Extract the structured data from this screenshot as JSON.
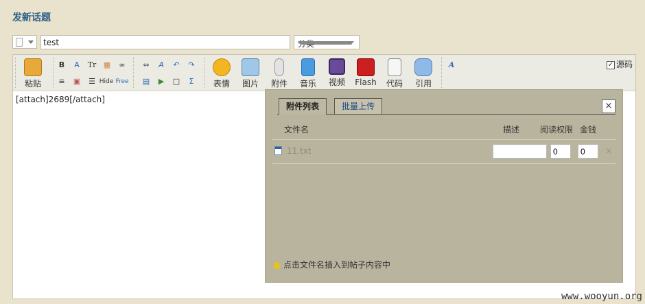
{
  "page": {
    "title": "发新话题"
  },
  "form": {
    "title_value": "test",
    "category_value": "分类"
  },
  "toolbar": {
    "paste": "粘贴",
    "big_buttons": [
      "表情",
      "图片",
      "附件",
      "音乐",
      "视频",
      "Flash",
      "代码",
      "引用"
    ],
    "small_row1": [
      "B",
      "A",
      "Tr",
      "▦",
      "∞",
      "⇔",
      "A",
      "↶",
      "↷"
    ],
    "small_row2": [
      "≡",
      "▣",
      "☰",
      "Hide",
      "Free",
      "▤",
      "▶",
      "□",
      "Σ"
    ],
    "source_label": "源码",
    "source_checked": true
  },
  "editor": {
    "content": "[attach]2689[/attach]"
  },
  "attach_panel": {
    "tab_active": "附件列表",
    "tab_inactive": "批量上传",
    "close": "×",
    "headers": {
      "file_name": "文件名",
      "desc": "描述",
      "perm": "阅读权限",
      "price": "金钱"
    },
    "file": {
      "name": "11.txt",
      "perm": "0",
      "price": "0",
      "delete": "×"
    },
    "hint": "点击文件名插入到帖子内容中"
  },
  "watermark": "www.wooyun.org"
}
